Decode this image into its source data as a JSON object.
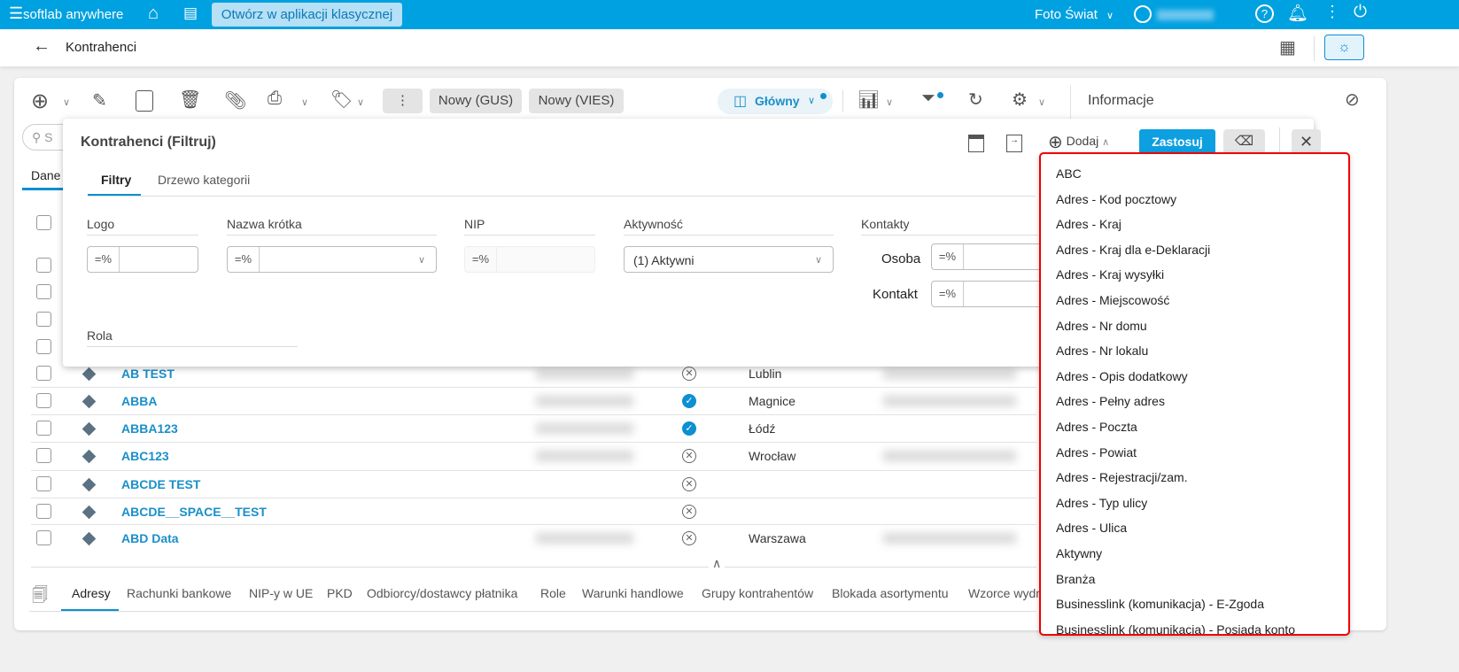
{
  "topbar": {
    "menu_icon": "hamburger-icon",
    "app_name": "softlab anywhere",
    "open_classic": "Otwórz w aplikacji klasycznej",
    "company": "Foto Świat"
  },
  "header": {
    "title": "Kontrahenci"
  },
  "toolbar": {
    "nowy_gus": "Nowy (GUS)",
    "nowy_vies": "Nowy (VIES)",
    "view": "Główny",
    "info": "Informacje",
    "search_placeholder": "S",
    "tab_dane": "Dane"
  },
  "filter": {
    "title": "Kontrahenci (Filtruj)",
    "tabs": [
      "Filtry",
      "Drzewo kategorii"
    ],
    "dodaj": "Dodaj",
    "zastosuj": "Zastosuj",
    "fields": {
      "logo": "Logo",
      "nazwa": "Nazwa krótka",
      "nip": "NIP",
      "aktywnosc": "Aktywność",
      "aktywnosc_value": "(1) Aktywni",
      "kontakty": "Kontakty",
      "osoba": "Osoba",
      "kontakt": "Kontakt",
      "rola": "Rola",
      "op": "=%"
    }
  },
  "dropdown": [
    "ABC",
    "Adres - Kod pocztowy",
    "Adres - Kraj",
    "Adres - Kraj dla e-Deklaracji",
    "Adres - Kraj wysyłki",
    "Adres - Miejscowość",
    "Adres - Nr domu",
    "Adres - Nr lokalu",
    "Adres - Opis dodatkowy",
    "Adres - Pełny adres",
    "Adres - Poczta",
    "Adres - Powiat",
    "Adres - Rejestracji/zam.",
    "Adres - Typ ulicy",
    "Adres - Ulica",
    "Aktywny",
    "Branża",
    "Businesslink (komunikacja) - E-Zgoda",
    "Businesslink (komunikacja) - Posiada konto"
  ],
  "rows": [
    {
      "name": "AB TEST",
      "active": false,
      "city": "Lublin"
    },
    {
      "name": "ABBA",
      "active": true,
      "city": "Magnice"
    },
    {
      "name": "ABBA123",
      "active": true,
      "city": "Łódź"
    },
    {
      "name": "ABC123",
      "active": false,
      "city": "Wrocław"
    },
    {
      "name": "ABCDE TEST",
      "active": false,
      "city": ""
    },
    {
      "name": "ABCDE__SPACE__TEST",
      "active": false,
      "city": ""
    },
    {
      "name": "ABD Data",
      "active": false,
      "city": "Warszawa"
    }
  ],
  "bottom_tabs": [
    "Adresy",
    "Rachunki bankowe",
    "NIP-y w UE",
    "PKD",
    "Odbiorcy/dostawcy płatnika",
    "Role",
    "Warunki handlowe",
    "Grupy kontrahentów",
    "Blokada asortymentu",
    "Wzorce wydr"
  ],
  "colors": {
    "brand": "#00a1e0",
    "accent": "#0d8fd1",
    "highlight": "#ee0000"
  }
}
